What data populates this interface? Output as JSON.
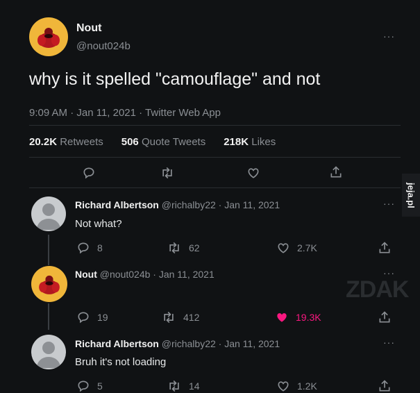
{
  "tweet": {
    "author_name": "Nout",
    "author_handle": "@nout024b",
    "text": "why is it spelled \"camouflage\" and not",
    "meta": "9:09 AM · Jan 11, 2021 · Twitter Web App",
    "stats": {
      "retweets_count": "20.2K",
      "retweets_label": "Retweets",
      "quotes_count": "506",
      "quotes_label": "Quote Tweets",
      "likes_count": "218K",
      "likes_label": "Likes"
    },
    "more": "···"
  },
  "replies": [
    {
      "author_name": "Richard Albertson",
      "meta": "@richalby22 · Jan 11, 2021",
      "text": "Not what?",
      "replies": "8",
      "retweets": "62",
      "likes": "2.7K",
      "more": "···"
    },
    {
      "author_name": "Nout",
      "meta": "@nout024b · Jan 11, 2021",
      "text": "",
      "replies": "19",
      "retweets": "412",
      "likes": "19.3K",
      "more": "···"
    },
    {
      "author_name": "Richard Albertson",
      "meta": "@richalby22 · Jan 11, 2021",
      "text": "Bruh it's not loading",
      "replies": "5",
      "retweets": "14",
      "likes": "1.2K",
      "more": "···"
    }
  ],
  "watermark": {
    "text": "jeja.pl",
    "overlay": "ZDAK"
  },
  "colors": {
    "background": "#101214",
    "liked": "#f91880",
    "muted": "#8b8f94",
    "avatar_nout": "#f0b63a"
  },
  "icons": [
    "reply-icon",
    "retweet-icon",
    "like-icon",
    "share-icon",
    "more-icon"
  ]
}
